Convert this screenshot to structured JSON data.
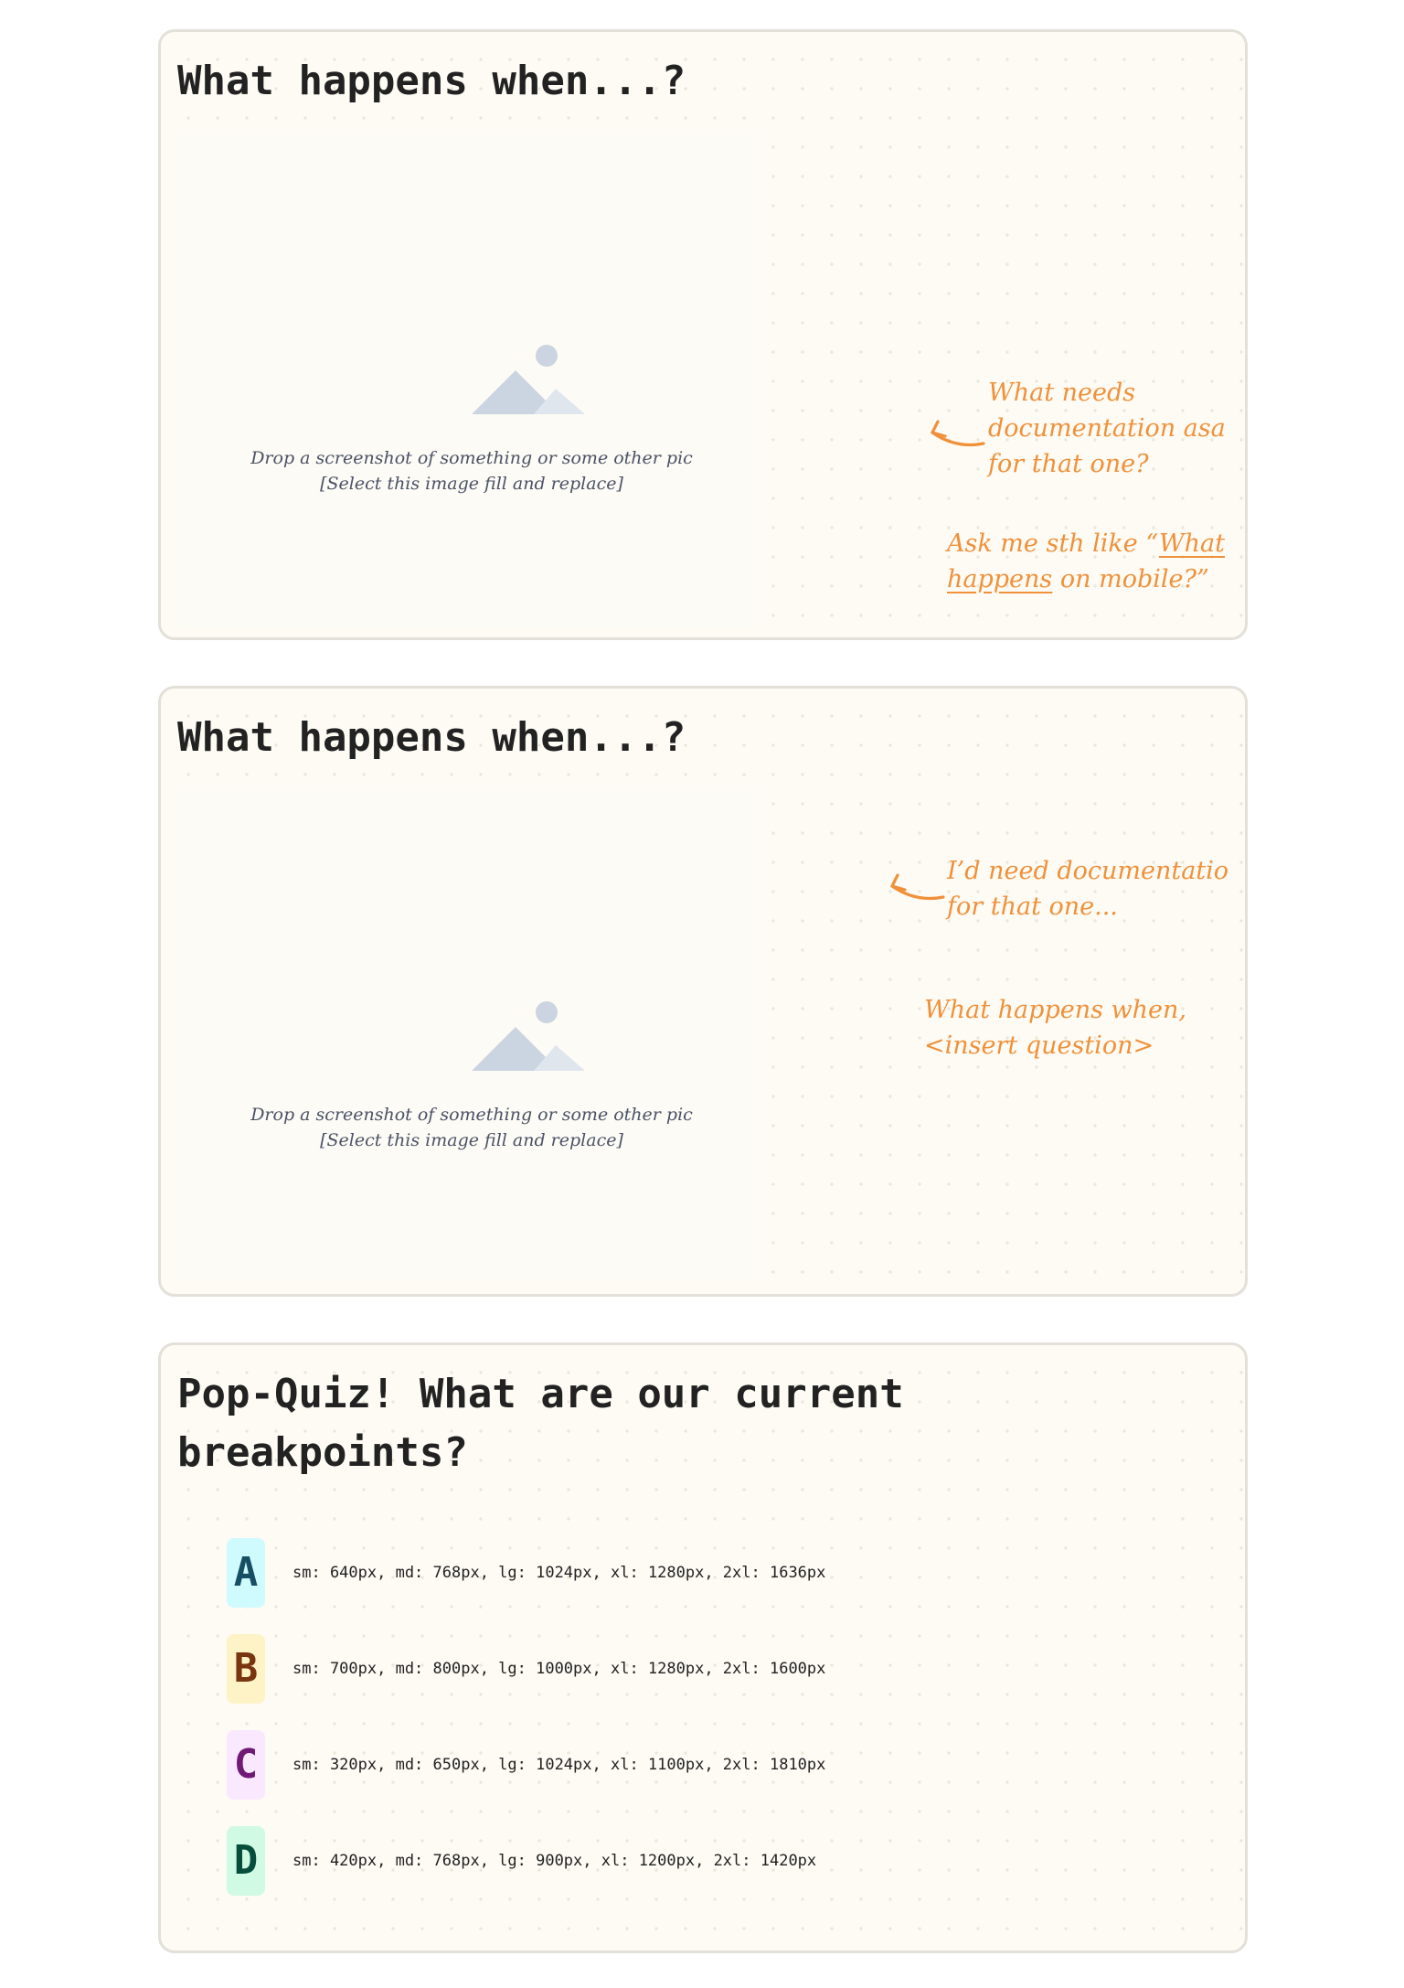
{
  "cards": [
    {
      "title": "What happens when...?",
      "placeholder": {
        "icon": "image-placeholder-icon",
        "line1": "Drop a screenshot of something or some other pic",
        "line2": "[Select this image fill and replace]"
      },
      "note1": {
        "lines": [
          "What needs",
          "documentation asa",
          "for that one?"
        ]
      },
      "note2": {
        "pre": "Ask me sth like “",
        "link_part1": "What",
        "link_part2": "happens",
        "post": " on mobile?”"
      }
    },
    {
      "title": "What happens when...?",
      "placeholder": {
        "icon": "image-placeholder-icon",
        "line1": "Drop a screenshot of something or some other pic",
        "line2": "[Select this image fill and replace]"
      },
      "note1": {
        "lines": [
          "I’d need documentatio",
          "for that one..."
        ]
      },
      "note2": {
        "lines": [
          "What happens when,",
          "<insert question>"
        ]
      }
    }
  ],
  "quiz": {
    "title_line1": "Pop-Quiz! What are our current",
    "title_line2": "breakpoints?",
    "options": [
      {
        "letter": "A",
        "text": "sm: 640px, md: 768px, lg: 1024px, xl: 1280px, 2xl: 1636px",
        "bg": "#cffafe",
        "fg": "#164e63"
      },
      {
        "letter": "B",
        "text": "sm: 700px, md: 800px, lg: 1000px, xl: 1280px, 2xl: 1600px",
        "bg": "#fef3c7",
        "fg": "#78350f"
      },
      {
        "letter": "C",
        "text": "sm: 320px, md: 650px, lg: 1024px, xl: 1100px, 2xl: 1810px",
        "bg": "#fae8ff",
        "fg": "#701a75"
      },
      {
        "letter": "D",
        "text": "sm: 420px, md: 768px, lg: 900px, xl: 1200px, 2xl: 1420px",
        "bg": "#d1fae5",
        "fg": "#064e3b"
      }
    ]
  },
  "colors": {
    "annotation": "#f0913a",
    "title": "#222222",
    "placeholder_icon": "#cbd5e1"
  }
}
